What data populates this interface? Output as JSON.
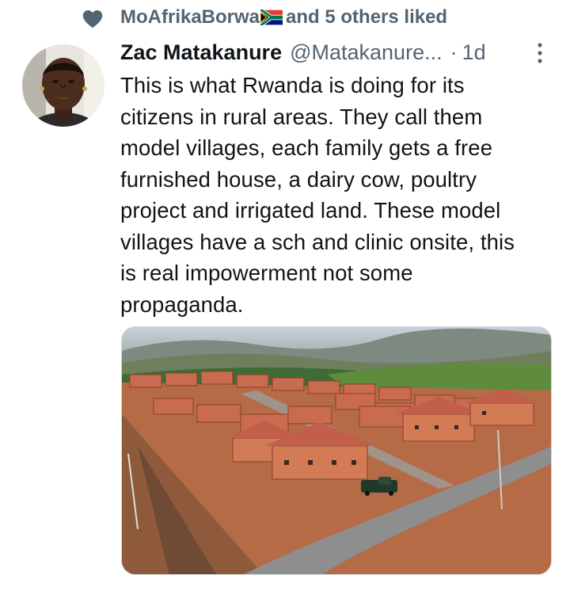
{
  "social_context": {
    "user": "MoAfrikaBorwa",
    "suffix": "and 5 others liked",
    "icon": "heart-icon",
    "flag_icon": "south-africa-flag-icon"
  },
  "tweet": {
    "display_name": "Zac Matakanure",
    "handle": "@Matakanure...",
    "separator": "·",
    "time": "1d",
    "text": "This is what Rwanda is doing for its\ncitizens in rural areas. They call them\nmodel villages, each family gets a free\nfurnished house, a dairy cow, poultry\nproject and irrigated land. These model\nvillages have a sch and clinic onsite, this\nis real impowerment not some\npropaganda.",
    "more_icon": "more-vertical-icon",
    "media": {
      "type": "photo",
      "subject": "aerial-view-model-village"
    }
  },
  "colors": {
    "text_primary": "#0f1419",
    "text_secondary": "#536471",
    "heart": "#536471"
  }
}
